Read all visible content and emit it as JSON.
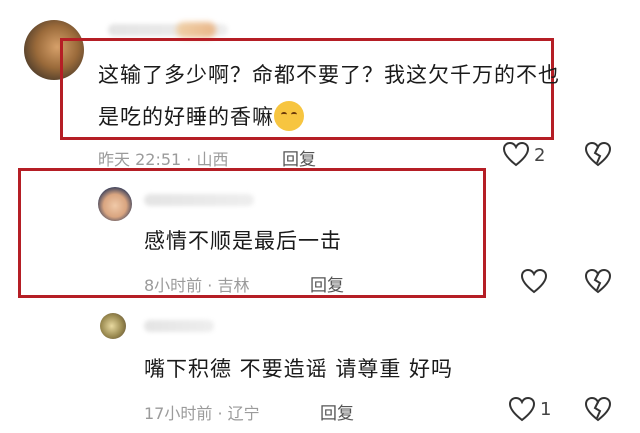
{
  "comments": [
    {
      "text_line1": "这输了多少啊？命都不要了？我这欠千万的不也",
      "text_line2": "是吃的好睡的香嘛",
      "emoji": "yawning-face",
      "time": "昨天 22:51",
      "location": "山西",
      "reply": "回复",
      "likes": "2"
    },
    {
      "text": "感情不顺是最后一击",
      "time": "8小时前",
      "location": "吉林",
      "reply": "回复",
      "likes": ""
    },
    {
      "text": "嘴下积德 不要造谣 请尊重 好吗",
      "time": "17小时前",
      "location": "辽宁",
      "reply": "回复",
      "likes": "1"
    }
  ],
  "colors": {
    "highlight_box": "#b51e25",
    "meta_text": "#9b9b9b"
  }
}
